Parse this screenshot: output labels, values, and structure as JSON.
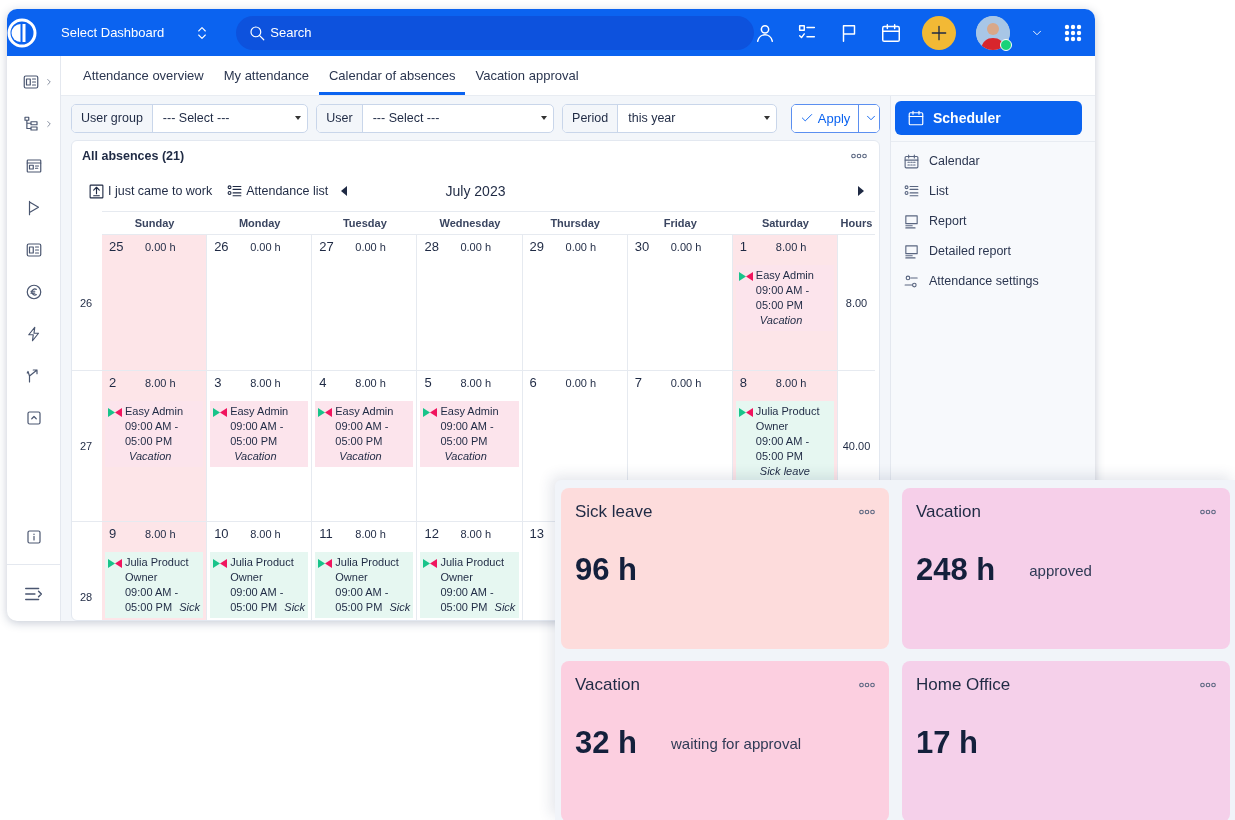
{
  "top_bar": {
    "dashboard_select": "Select Dashboard",
    "search": {
      "placeholder": "Search"
    }
  },
  "tabs": [
    {
      "label": "Attendance overview",
      "selected": false
    },
    {
      "label": "My attendance",
      "selected": false
    },
    {
      "label": "Calendar of absences",
      "selected": true
    },
    {
      "label": "Vacation approval",
      "selected": false
    }
  ],
  "filters": [
    {
      "label": "User group",
      "value": "--- Select ---"
    },
    {
      "label": "User",
      "value": "--- Select ---"
    },
    {
      "label": "Period",
      "value": "this year"
    }
  ],
  "apply_button": "Apply",
  "calendar": {
    "title": "All absences (21)",
    "actions": [
      "I just came to work",
      "Attendance list"
    ],
    "month": "July 2023",
    "columns": [
      "Sunday",
      "Monday",
      "Tuesday",
      "Wednesday",
      "Thursday",
      "Friday",
      "Saturday",
      "Hours"
    ],
    "weeks": [
      {
        "week": "26",
        "hours": "8.00",
        "cells": [
          {
            "day": "25",
            "hours": "0.00 h",
            "weekend": true
          },
          {
            "day": "26",
            "hours": "0.00 h",
            "weekend": false
          },
          {
            "day": "27",
            "hours": "0.00 h",
            "weekend": false
          },
          {
            "day": "28",
            "hours": "0.00 h",
            "weekend": false
          },
          {
            "day": "29",
            "hours": "0.00 h",
            "weekend": false
          },
          {
            "day": "30",
            "hours": "0.00 h",
            "weekend": false
          },
          {
            "day": "1",
            "hours": "8.00 h",
            "weekend": true,
            "events": [
              {
                "name": "Easy Admin",
                "time": "09:00 AM - 05:00 PM",
                "type": "Vacation",
                "color": "#fce4ec"
              }
            ]
          }
        ]
      },
      {
        "week": "27",
        "hours": "40.00",
        "cells": [
          {
            "day": "2",
            "hours": "8.00 h",
            "weekend": true,
            "events": [
              {
                "name": "Easy Admin",
                "time": "09:00 AM - 05:00 PM",
                "type": "Vacation",
                "color": "#fce4ec"
              }
            ]
          },
          {
            "day": "3",
            "hours": "8.00 h",
            "weekend": false,
            "events": [
              {
                "name": "Easy Admin",
                "time": "09:00 AM - 05:00 PM",
                "type": "Vacation",
                "color": "#fce4ec"
              }
            ]
          },
          {
            "day": "4",
            "hours": "8.00 h",
            "weekend": false,
            "events": [
              {
                "name": "Easy Admin",
                "time": "09:00 AM - 05:00 PM",
                "type": "Vacation",
                "color": "#fce4ec"
              }
            ]
          },
          {
            "day": "5",
            "hours": "8.00 h",
            "weekend": false,
            "events": [
              {
                "name": "Easy Admin",
                "time": "09:00 AM - 05:00 PM",
                "type": "Vacation",
                "color": "#fce4ec"
              }
            ]
          },
          {
            "day": "6",
            "hours": "0.00 h",
            "weekend": false
          },
          {
            "day": "7",
            "hours": "0.00 h",
            "weekend": false
          },
          {
            "day": "8",
            "hours": "8.00 h",
            "weekend": true,
            "events": [
              {
                "name": "Julia Product Owner",
                "time": "09:00 AM - 05:00 PM",
                "type": "Sick leave",
                "color": "#e6f7f1"
              }
            ]
          }
        ]
      },
      {
        "week": "28",
        "cells": [
          {
            "day": "9",
            "hours": "8.00 h",
            "weekend": true,
            "events": [
              {
                "name": "Julia Product Owner",
                "time": "09:00 AM - 05:00 PM",
                "type": "Sick",
                "color": "#e6f7f1"
              }
            ]
          },
          {
            "day": "10",
            "hours": "8.00 h",
            "weekend": false,
            "events": [
              {
                "name": "Julia Product Owner",
                "time": "09:00 AM - 05:00 PM",
                "type": "Sick",
                "color": "#e6f7f1"
              }
            ]
          },
          {
            "day": "11",
            "hours": "8.00 h",
            "weekend": false,
            "events": [
              {
                "name": "Julia Product Owner",
                "time": "09:00 AM - 05:00 PM",
                "type": "Sick",
                "color": "#e6f7f1"
              }
            ]
          },
          {
            "day": "12",
            "hours": "8.00 h",
            "weekend": false,
            "events": [
              {
                "name": "Julia Product Owner",
                "time": "09:00 AM - 05:00 PM",
                "type": "Sick",
                "color": "#e6f7f1"
              }
            ]
          },
          {
            "day": "13",
            "weekend": false
          }
        ]
      }
    ]
  },
  "side_panel": {
    "primary": "Scheduler",
    "links": [
      "Calendar",
      "List",
      "Report",
      "Detailed report",
      "Attendance settings"
    ]
  },
  "summary_cards": [
    {
      "title": "Sick leave",
      "value": "96 h",
      "color": "#fddcdc"
    },
    {
      "title": "Vacation",
      "value": "248 h",
      "note": "approved",
      "color": "#f6cfe9"
    },
    {
      "title": "Vacation",
      "value": "32 h",
      "note": "waiting for approval",
      "color": "#fccfe0"
    },
    {
      "title": "Home Office",
      "value": "17 h",
      "color": "#f5d0ea"
    }
  ]
}
